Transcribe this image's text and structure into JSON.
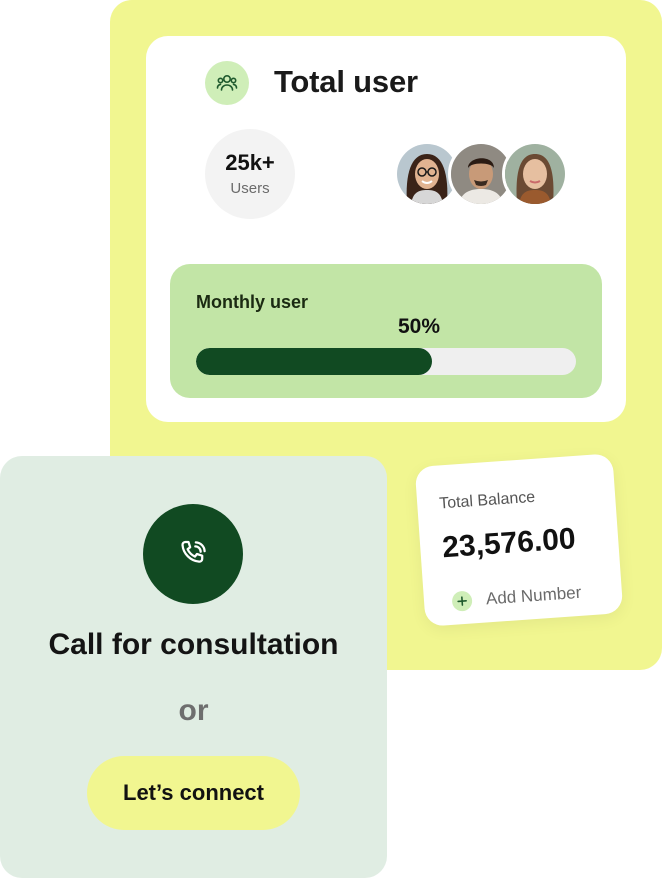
{
  "colors": {
    "yellow_accent": "#f1f690",
    "green_dark": "#114a22",
    "green_light": "#c2e5a6",
    "mint_background": "#e0ede3",
    "icon_tint": "#cfeeb8"
  },
  "user_card": {
    "title": "Total user",
    "icon": "users-icon",
    "users_count": "25k+",
    "users_label": "Users",
    "avatars": [
      {
        "icon": "avatar-woman-glasses"
      },
      {
        "icon": "avatar-man"
      },
      {
        "icon": "avatar-woman"
      }
    ],
    "monthly": {
      "label": "Monthly user",
      "percent_text": "50%",
      "progress": 0.62
    }
  },
  "balance_card": {
    "label": "Total Balance",
    "value": "23,576.00",
    "add_label": "Add Number",
    "add_icon": "plus-icon"
  },
  "consult_card": {
    "icon": "phone-call-icon",
    "title": "Call for consultation",
    "or_text": "or",
    "button_label": "Let’s connect"
  }
}
